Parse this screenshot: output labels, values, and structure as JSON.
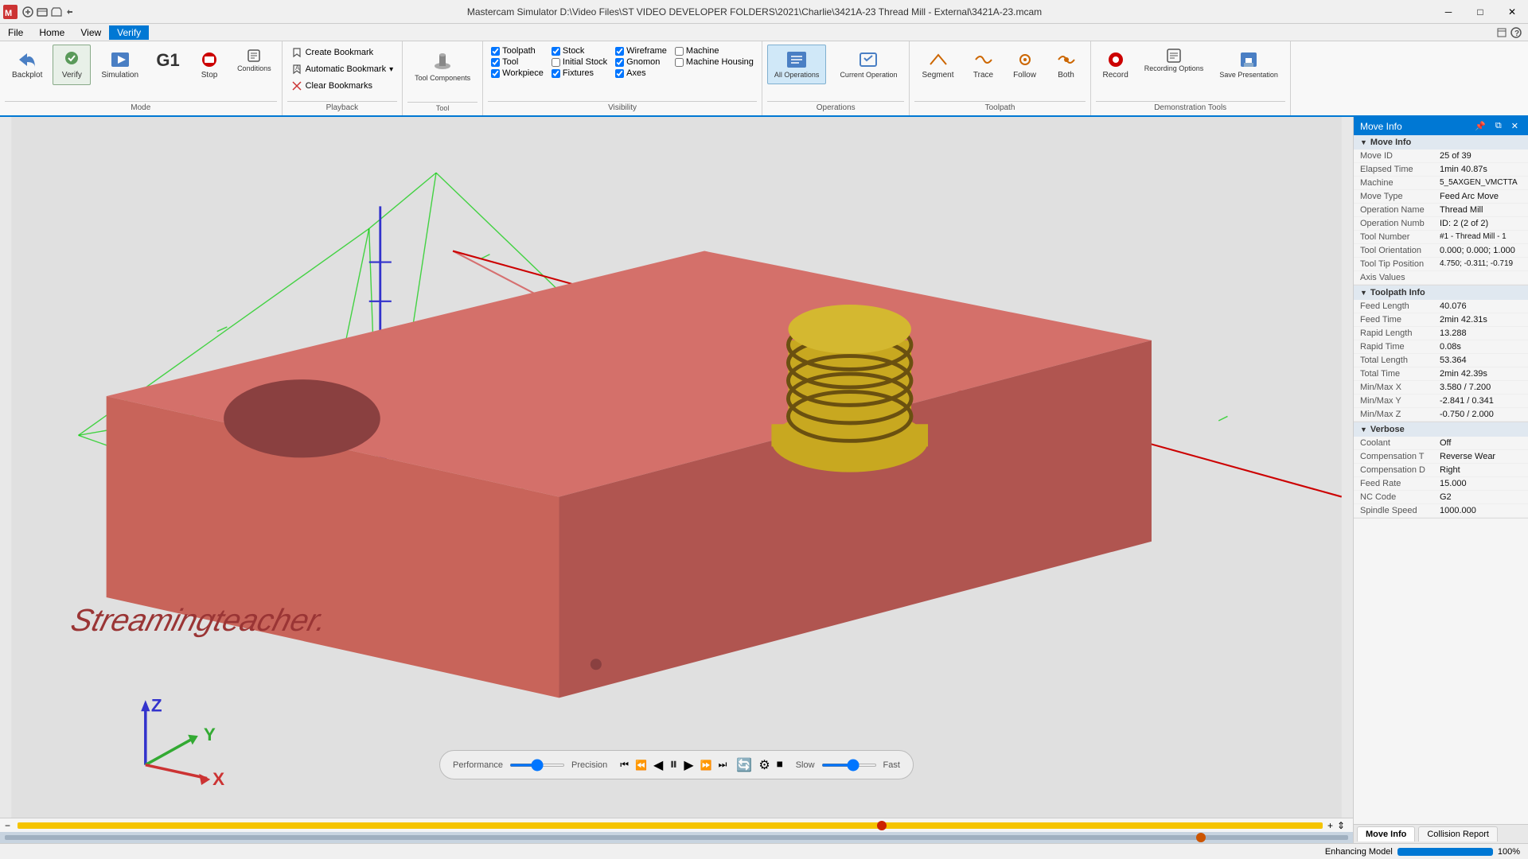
{
  "titlebar": {
    "title": "Mastercam Simulator  D:\\Video Files\\ST VIDEO DEVELOPER FOLDERS\\2021\\Charlie\\3421A-23 Thread Mill - External\\3421A-23.mcam",
    "min_label": "─",
    "max_label": "□",
    "close_label": "✕"
  },
  "menubar": {
    "items": [
      "File",
      "Home",
      "View",
      "Verify"
    ]
  },
  "ribbon": {
    "mode_group": "Mode",
    "playback_group": "Playback",
    "visibility_group": "Visibility",
    "operations_group": "Operations",
    "toolpath_group": "Toolpath",
    "demo_group": "Demonstration Tools",
    "backplot_label": "Backplot",
    "verify_label": "Verify",
    "simulation_label": "Simulation",
    "g1_label": "G1",
    "stop_label": "Stop",
    "conditions_label": "Conditions",
    "create_bookmark": "Create Bookmark",
    "auto_bookmark": "Automatic Bookmark",
    "clear_bookmarks": "Clear Bookmarks",
    "tool_components_label": "Tool Components",
    "toolpath_cb": "Toolpath",
    "stock_cb": "Stock",
    "wireframe_cb": "Wireframe",
    "machine_cb": "Machine",
    "tool_cb": "Tool",
    "initial_stock_cb": "Initial Stock",
    "gnomon_cb": "Gnomon",
    "machine_housing_cb": "Machine Housing",
    "workpiece_cb": "Workpiece",
    "fixtures_cb": "Fixtures",
    "axes_cb": "Axes",
    "all_operations_label": "All Operations",
    "current_operation_label": "Current Operation",
    "segment_label": "Segment",
    "trace_label": "Trace",
    "follow_label": "Follow",
    "both_label": "Both",
    "record_label": "Record",
    "recording_options_label": "Recording Options",
    "save_presentation_label": "Save Presentation"
  },
  "move_info": {
    "panel_title": "Move Info",
    "sections": {
      "move_info": {
        "label": "Move Info",
        "rows": [
          {
            "label": "Move ID",
            "value": "25 of 39"
          },
          {
            "label": "Elapsed Time",
            "value": "1min 40.87s"
          },
          {
            "label": "Machine",
            "value": "5_5AXGEN_VMCTTA"
          },
          {
            "label": "Move Type",
            "value": "Feed Arc Move"
          },
          {
            "label": "Operation Name",
            "value": "Thread Mill"
          },
          {
            "label": "Operation Numb",
            "value": "ID: 2 (2 of 2)"
          },
          {
            "label": "Tool Number",
            "value": "#1 - Thread Mill - 1"
          },
          {
            "label": "Tool Orientation",
            "value": "0.000; 0.000; 1.000"
          },
          {
            "label": "Tool Tip Position",
            "value": "4.750; -0.311; -0.719"
          },
          {
            "label": "Axis Values",
            "value": ""
          }
        ]
      },
      "toolpath_info": {
        "label": "Toolpath Info",
        "rows": [
          {
            "label": "Feed Length",
            "value": "40.076"
          },
          {
            "label": "Feed Time",
            "value": "2min 42.31s"
          },
          {
            "label": "Rapid Length",
            "value": "13.288"
          },
          {
            "label": "Rapid Time",
            "value": "0.08s"
          },
          {
            "label": "Total Length",
            "value": "53.364"
          },
          {
            "label": "Total Time",
            "value": "2min 42.39s"
          },
          {
            "label": "Min/Max X",
            "value": "3.580 / 7.200"
          },
          {
            "label": "Min/Max Y",
            "value": "-2.841 / 0.341"
          },
          {
            "label": "Min/Max Z",
            "value": "-0.750 / 2.000"
          }
        ]
      },
      "verbose": {
        "label": "Verbose",
        "rows": [
          {
            "label": "Coolant",
            "value": "Off"
          },
          {
            "label": "Compensation T",
            "value": "Reverse Wear"
          },
          {
            "label": "Compensation D",
            "value": "Right"
          },
          {
            "label": "Feed Rate",
            "value": "15.000"
          },
          {
            "label": "NC Code",
            "value": "G2"
          },
          {
            "label": "Spindle Speed",
            "value": "1000.000"
          }
        ]
      }
    }
  },
  "playback": {
    "perf_label": "Performance",
    "prec_label": "Precision",
    "slow_label": "Slow",
    "fast_label": "Fast"
  },
  "panel_tabs": {
    "move_info": "Move Info",
    "collision_report": "Collision Report"
  },
  "statusbar": {
    "left_text": "Enhancing Model",
    "progress_pct": 100,
    "pct_label": "100%"
  },
  "model_text": "Streamingteacher.",
  "icons": {
    "backplot": "⟵",
    "verify": "✓",
    "simulation": "▶",
    "stop": "⏹",
    "bookmark": "🔖",
    "record": "⏺",
    "save": "💾",
    "play": "▶",
    "pause": "⏸",
    "skip_end": "⏭",
    "skip_start": "⏮",
    "step_fwd": "⏩",
    "step_back": "⏪",
    "loop": "🔄",
    "frame_back": "◀",
    "frame_fwd": "▶"
  }
}
